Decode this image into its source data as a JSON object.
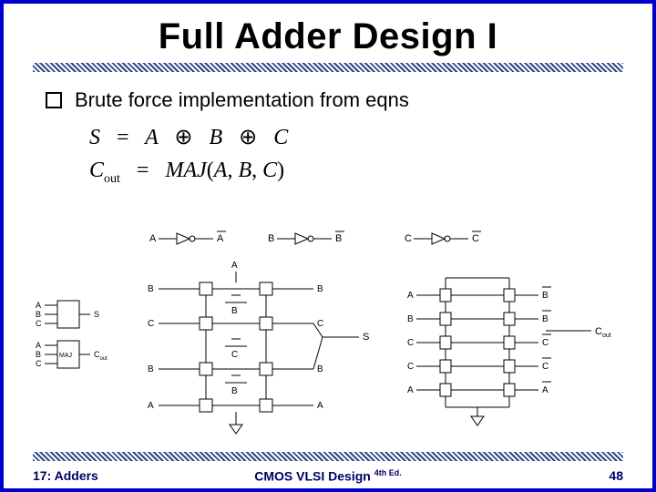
{
  "title": "Full Adder Design I",
  "bullet": "Brute force implementation from eqns",
  "equations": {
    "sum_lhs": "S",
    "sum_rhs_a": "A",
    "sum_rhs_b": "B",
    "sum_rhs_c": "C",
    "xor": "⊕",
    "eq": "=",
    "cout_lhs": "C",
    "cout_sub": "out",
    "maj": "MAJ",
    "lp": "(",
    "rp": ")",
    "comma": ",",
    "arg_a": "A",
    "arg_b": "B",
    "arg_c": "C"
  },
  "signals": {
    "A": "A",
    "B": "B",
    "C": "C",
    "Abar": "A",
    "Bbar": "B",
    "Cbar": "C",
    "S": "S",
    "Cout_C": "C",
    "Cout_sub": "out"
  },
  "block": {
    "xor": "",
    "maj": "MAJ"
  },
  "footer": {
    "left": "17: Adders",
    "center_main": "CMOS VLSI Design",
    "center_ed": "4th Ed.",
    "right": "48"
  }
}
